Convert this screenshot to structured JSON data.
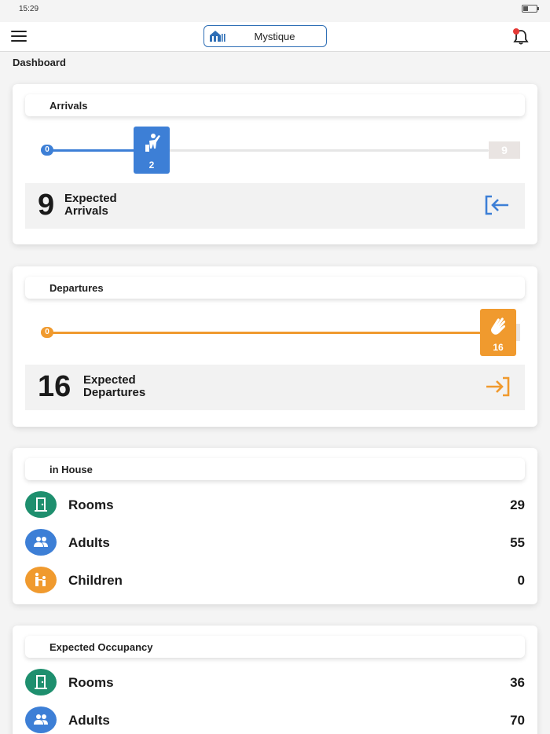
{
  "status": {
    "time": "15:29"
  },
  "header": {
    "property_name": "Mystique"
  },
  "page": {
    "title": "Dashboard"
  },
  "colors": {
    "accent_blue": "#3d7fd6",
    "accent_orange": "#f09a2e",
    "rooms_green": "#1e8f6e"
  },
  "arrivals": {
    "title": "Arrivals",
    "start": "0",
    "end": "9",
    "current": "2",
    "progress": 0.22,
    "expected_count": "9",
    "expected_label_1": "Expected",
    "expected_label_2": "Arrivals"
  },
  "departures": {
    "title": "Departures",
    "start": "0",
    "current": "16",
    "progress": 1.0,
    "expected_count": "16",
    "expected_label_1": "Expected",
    "expected_label_2": "Departures"
  },
  "in_house": {
    "title": "in House",
    "rooms": {
      "label": "Rooms",
      "value": "29"
    },
    "adults": {
      "label": "Adults",
      "value": "55"
    },
    "children": {
      "label": "Children",
      "value": "0"
    }
  },
  "expected_occupancy": {
    "title": "Expected Occupancy",
    "rooms": {
      "label": "Rooms",
      "value": "36"
    },
    "adults": {
      "label": "Adults",
      "value": "70"
    }
  }
}
